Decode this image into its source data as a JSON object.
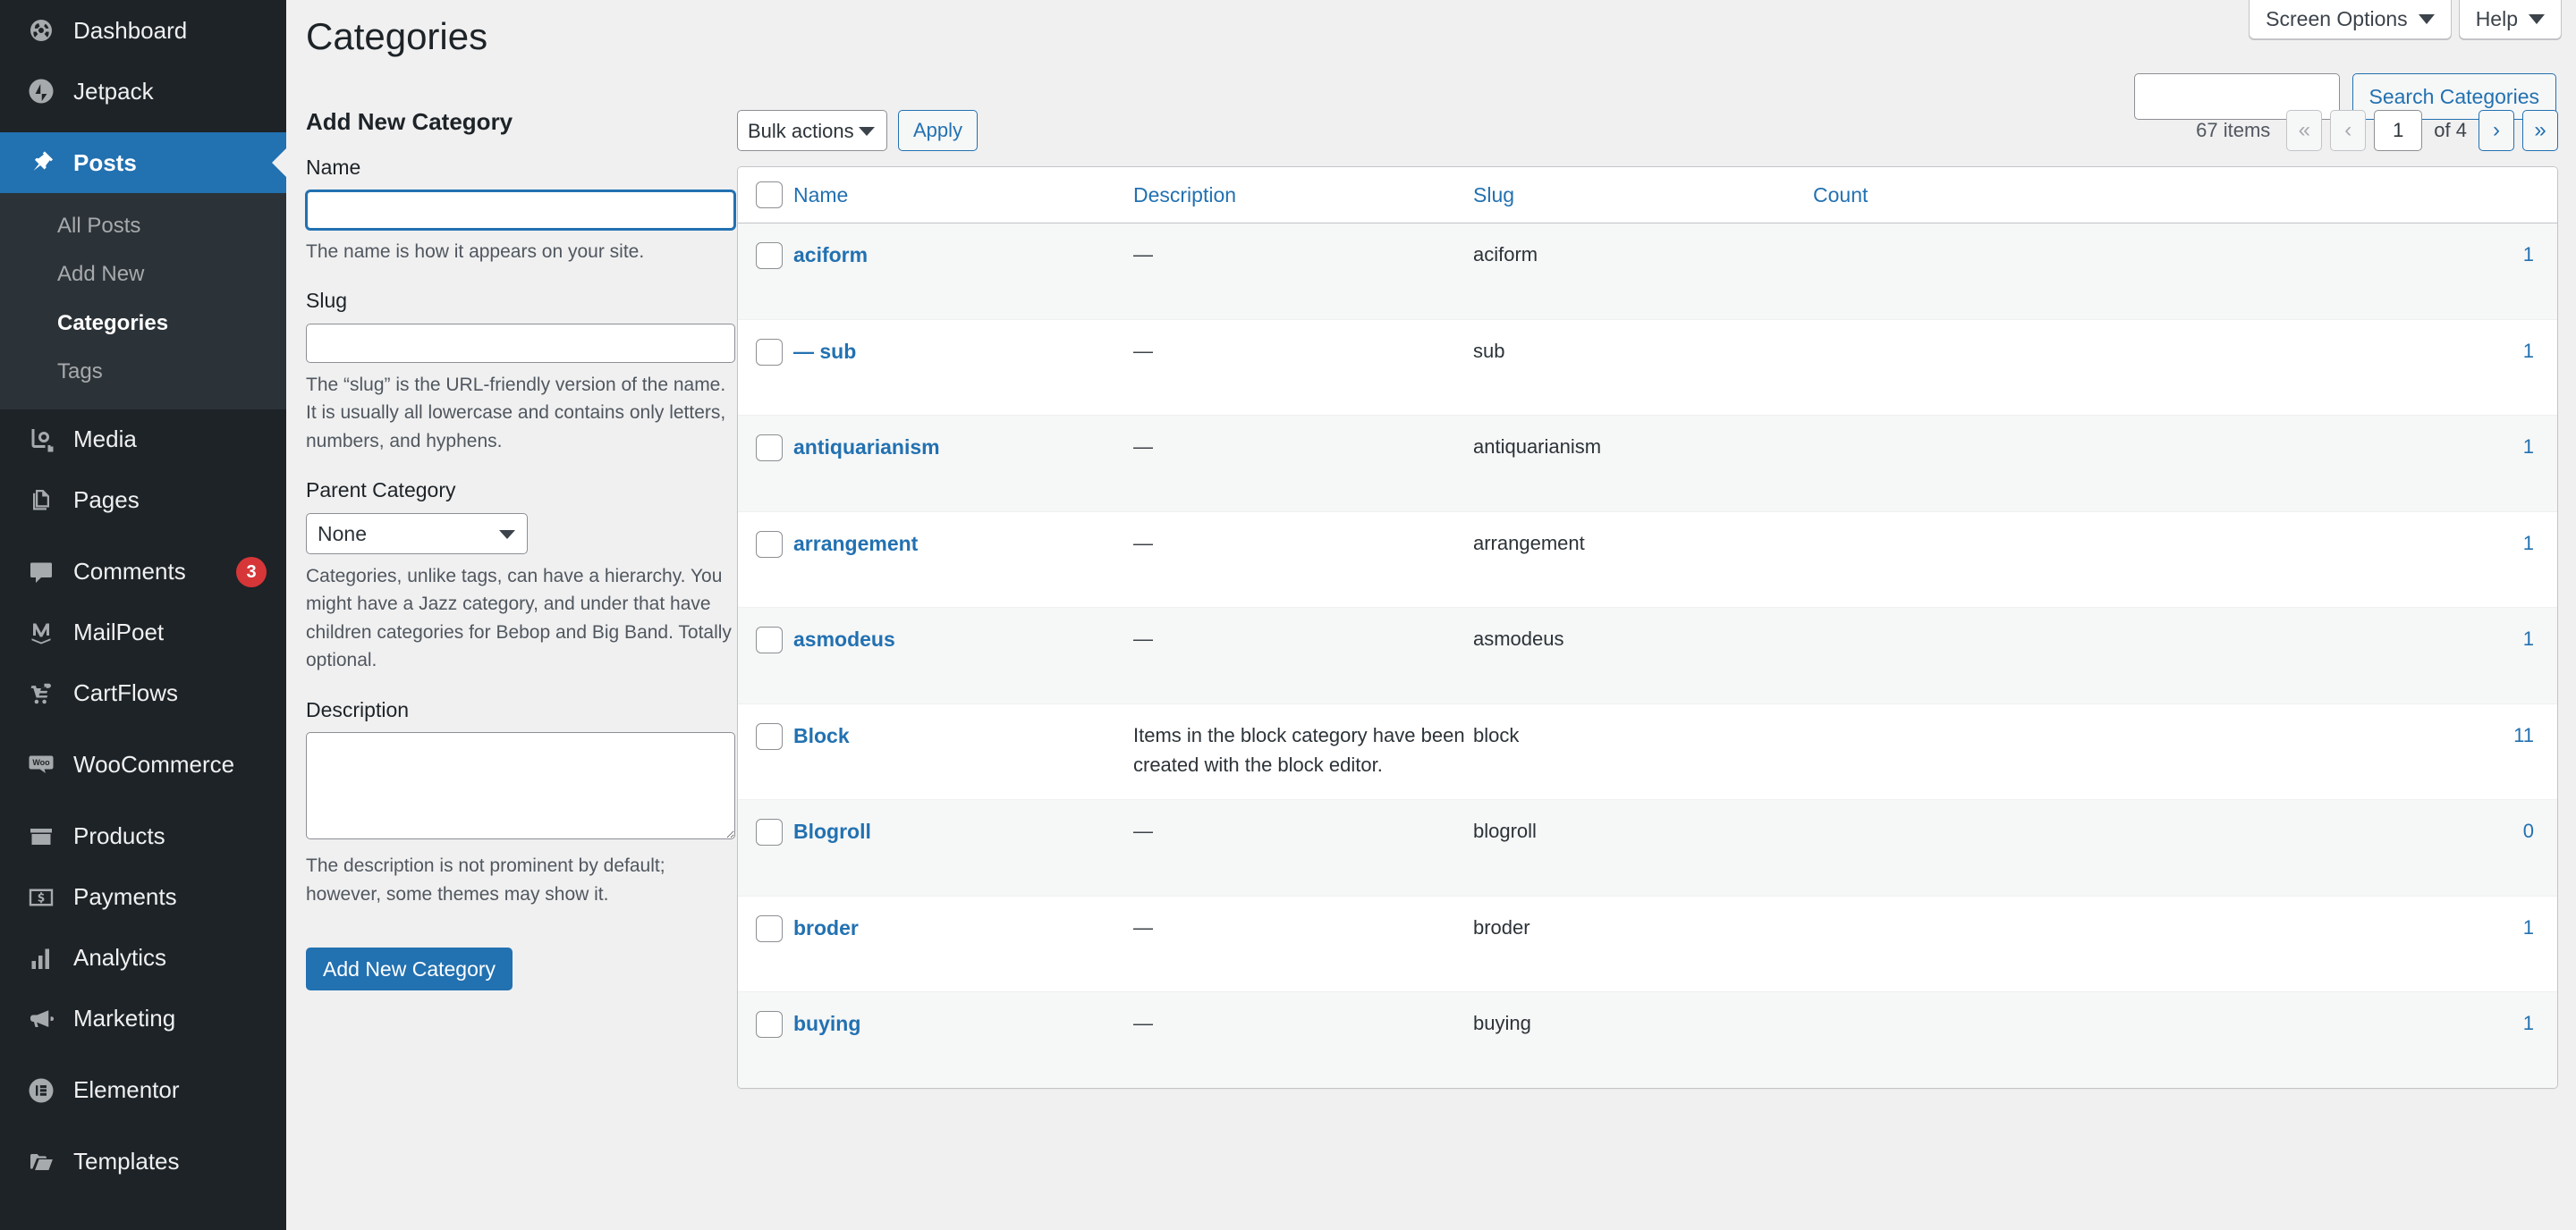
{
  "colors": {
    "accent": "#2271b1",
    "sidebar_bg": "#1d2327",
    "submenu_bg": "#2c3338",
    "page_bg": "#f0f0f1",
    "badge_red": "#d63638",
    "alt_row": "#f6f7f7"
  },
  "sidebar": {
    "items": [
      {
        "label": "Dashboard",
        "icon": "dashboard-icon",
        "current": false
      },
      {
        "label": "Jetpack",
        "icon": "jetpack-icon",
        "current": false
      },
      {
        "label": "Posts",
        "icon": "pin-icon",
        "current": true
      },
      {
        "label": "Media",
        "icon": "media-icon",
        "current": false
      },
      {
        "label": "Pages",
        "icon": "pages-icon",
        "current": false
      },
      {
        "label": "Comments",
        "icon": "comment-icon",
        "current": false,
        "badge": "3"
      },
      {
        "label": "MailPoet",
        "icon": "mailpoet-icon",
        "current": false
      },
      {
        "label": "CartFlows",
        "icon": "cartflows-icon",
        "current": false
      },
      {
        "label": "WooCommerce",
        "icon": "woo-icon",
        "current": false
      },
      {
        "label": "Products",
        "icon": "products-icon",
        "current": false
      },
      {
        "label": "Payments",
        "icon": "payments-icon",
        "current": false
      },
      {
        "label": "Analytics",
        "icon": "analytics-icon",
        "current": false
      },
      {
        "label": "Marketing",
        "icon": "marketing-icon",
        "current": false
      },
      {
        "label": "Elementor",
        "icon": "elementor-icon",
        "current": false
      },
      {
        "label": "Templates",
        "icon": "templates-icon",
        "current": false
      }
    ],
    "submenu": [
      {
        "label": "All Posts",
        "current": false
      },
      {
        "label": "Add New",
        "current": false
      },
      {
        "label": "Categories",
        "current": true
      },
      {
        "label": "Tags",
        "current": false
      }
    ]
  },
  "screen_meta": {
    "screen_options_label": "Screen Options",
    "help_label": "Help"
  },
  "header": {
    "title": "Categories"
  },
  "search": {
    "value": "",
    "placeholder": "",
    "button_label": "Search Categories"
  },
  "form": {
    "heading": "Add New Category",
    "name_label": "Name",
    "name_value": "",
    "name_help": "The name is how it appears on your site.",
    "slug_label": "Slug",
    "slug_value": "",
    "slug_help": "The “slug” is the URL-friendly version of the name. It is usually all lowercase and contains only letters, numbers, and hyphens.",
    "parent_label": "Parent Category",
    "parent_value": "None",
    "parent_options": [
      "None"
    ],
    "parent_help": "Categories, unlike tags, can have a hierarchy. You might have a Jazz category, and under that have children categories for Bebop and Big Band. Totally optional.",
    "description_label": "Description",
    "description_value": "",
    "description_help": "The description is not prominent by default; however, some themes may show it.",
    "submit_label": "Add New Category"
  },
  "tablenav": {
    "bulk_value": "Bulk actions",
    "bulk_options": [
      "Bulk actions"
    ],
    "apply_label": "Apply",
    "items_count": "67 items",
    "first_label": "«",
    "prev_label": "‹",
    "current_page": "1",
    "of_total": "of 4",
    "next_label": "›",
    "last_label": "»"
  },
  "table": {
    "columns": [
      "Name",
      "Description",
      "Slug",
      "Count"
    ],
    "rows": [
      {
        "name": "aciform",
        "description": "—",
        "slug": "aciform",
        "count": "1"
      },
      {
        "name": "— sub",
        "description": "—",
        "slug": "sub",
        "count": "1"
      },
      {
        "name": "antiquarianism",
        "description": "—",
        "slug": "antiquarianism",
        "count": "1"
      },
      {
        "name": "arrangement",
        "description": "—",
        "slug": "arrangement",
        "count": "1"
      },
      {
        "name": "asmodeus",
        "description": "—",
        "slug": "asmodeus",
        "count": "1"
      },
      {
        "name": "Block",
        "description": "Items in the block category have been created with the block editor.",
        "slug": "block",
        "count": "11"
      },
      {
        "name": "Blogroll",
        "description": "—",
        "slug": "blogroll",
        "count": "0"
      },
      {
        "name": "broder",
        "description": "—",
        "slug": "broder",
        "count": "1"
      },
      {
        "name": "buying",
        "description": "—",
        "slug": "buying",
        "count": "1"
      }
    ]
  }
}
